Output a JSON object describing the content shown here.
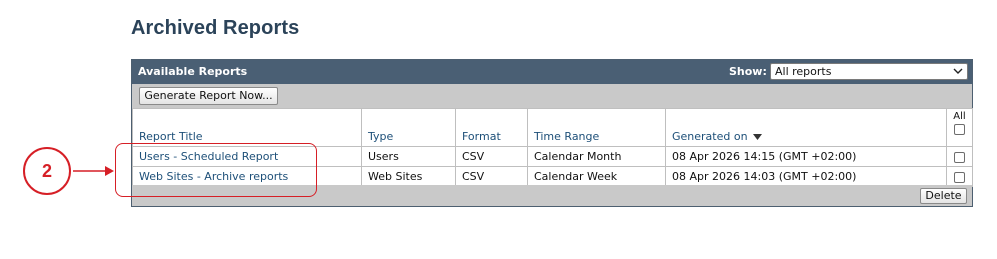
{
  "page": {
    "title": "Archived Reports"
  },
  "panel": {
    "title": "Available Reports",
    "show_label": "Show:",
    "show_selected": "All reports",
    "generate_button": "Generate Report Now...",
    "delete_button": "Delete"
  },
  "table": {
    "columns": [
      "Report Title",
      "Type",
      "Format",
      "Time Range",
      "Generated on"
    ],
    "all_label": "All",
    "sort_column": "Generated on",
    "sort_direction": "descending",
    "rows": [
      {
        "title": "Users - Scheduled Report",
        "type": "Users",
        "format": "CSV",
        "time_range": "Calendar Month",
        "generated_on": "08 Apr 2026 14:15 (GMT +02:00)",
        "checked": false
      },
      {
        "title": "Web Sites - Archive reports",
        "type": "Web Sites",
        "format": "CSV",
        "time_range": "Calendar Week",
        "generated_on": "08 Apr 2026 14:03 (GMT +02:00)",
        "checked": false
      }
    ]
  },
  "annotation": {
    "number": "2",
    "color": "#d61f26"
  },
  "colors": {
    "header_bg": "#4a5f74",
    "toolbar_bg": "#c9c9c9",
    "link": "#1d4f78",
    "title": "#2b4359"
  },
  "icons": {
    "select_chevron": "chevron-down-icon",
    "sort": "sort-descending-icon",
    "annotation_arrow": "arrow-right-icon"
  }
}
